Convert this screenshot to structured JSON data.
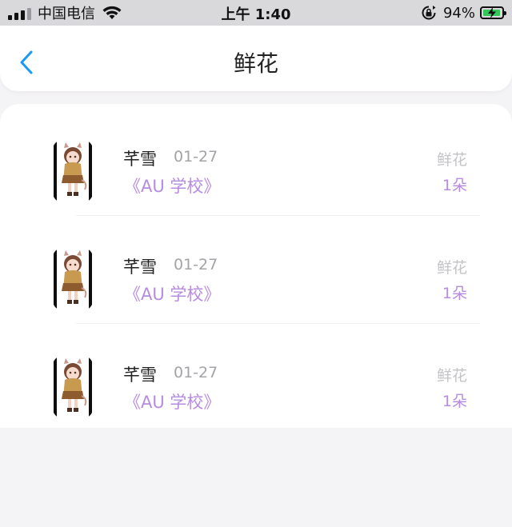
{
  "status_bar": {
    "carrier": "中国电信",
    "time": "上午 1:40",
    "battery": "94%",
    "battery_level": 0.94,
    "icons": [
      "signal-icon",
      "wifi-icon",
      "rotation-lock-icon",
      "battery-charging-icon"
    ]
  },
  "nav": {
    "title": "鲜花",
    "back_icon": "chevron-left-icon"
  },
  "colors": {
    "accent": "#1a9af7",
    "book": "#b68ce0",
    "muted": "#a3a3a8"
  },
  "gifts": [
    {
      "name": "芊雪",
      "date": "01-27",
      "book": "《AU 学校》",
      "gift": "鲜花",
      "qty": "1朵"
    },
    {
      "name": "芊雪",
      "date": "01-27",
      "book": "《AU 学校》",
      "gift": "鲜花",
      "qty": "1朵"
    },
    {
      "name": "芊雪",
      "date": "01-27",
      "book": "《AU 学校》",
      "gift": "鲜花",
      "qty": "1朵"
    }
  ]
}
